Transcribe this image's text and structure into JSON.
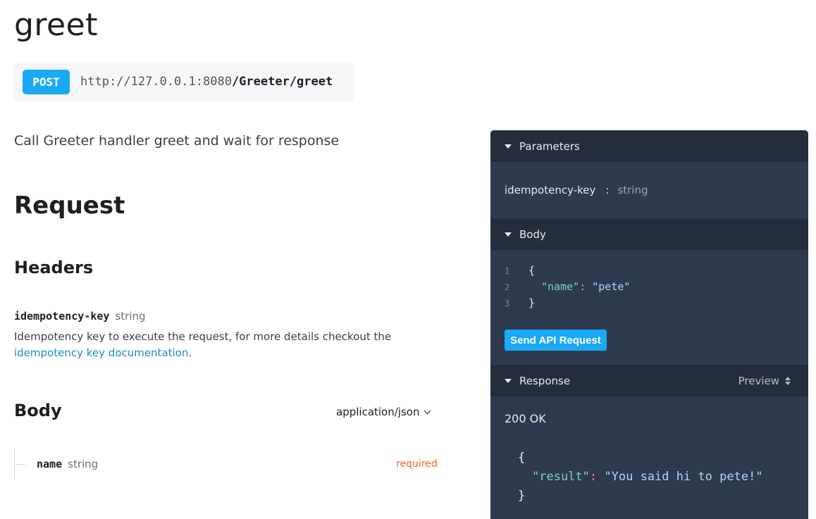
{
  "page": {
    "title": "greet",
    "description": "Call Greeter handler greet and wait for response"
  },
  "endpoint": {
    "method": "POST",
    "base_url": "http://127.0.0.1:8080",
    "path": "/Greeter/greet"
  },
  "request": {
    "heading": "Request",
    "headers_heading": "Headers",
    "header_param": {
      "name": "idempotency-key",
      "type": "string",
      "description_prefix": "Idempotency key to execute the request, for more details checkout the ",
      "link_text": "idempotency key documentation",
      "description_suffix": "."
    },
    "body_heading": "Body",
    "content_type": "application/json",
    "body_field": {
      "name": "name",
      "type": "string",
      "required_label": "required"
    }
  },
  "panel": {
    "parameters_label": "Parameters",
    "param_name": "idempotency-key",
    "param_colon": ":",
    "param_type": "string",
    "body_label": "Body",
    "body_lines": [
      {
        "num": "1",
        "open": "{"
      },
      {
        "num": "2",
        "key": "\"name\"",
        "colon": ":",
        "value": "\"pete\""
      },
      {
        "num": "3",
        "close": "}"
      }
    ],
    "send_button": "Send API Request",
    "response_label": "Response",
    "preview_label": "Preview",
    "status": "200 OK",
    "response_lines": {
      "open": "{",
      "key": "\"result\"",
      "colon": ":",
      "value": "\"You said hi to pete!\"",
      "close": "}"
    }
  },
  "colors": {
    "accent": "#1aa9f5",
    "link": "#1c8cc9",
    "required": "#e8692b",
    "panel_bg": "#2e3a4d",
    "panel_header_bg": "#232d3c"
  }
}
